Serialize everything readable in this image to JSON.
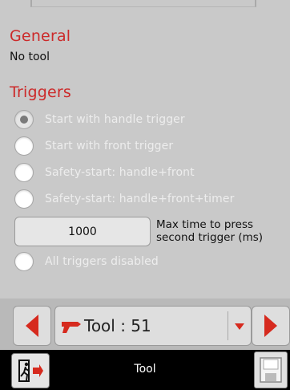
{
  "general": {
    "heading": "General",
    "tool_value": "No tool"
  },
  "triggers": {
    "heading": "Triggers",
    "options": [
      {
        "label": "Start with handle trigger",
        "checked": true
      },
      {
        "label": "Start with front trigger",
        "checked": false
      },
      {
        "label": "Safety-start: handle+front",
        "checked": false
      },
      {
        "label": "Safety-start: handle+front+timer",
        "checked": false
      }
    ],
    "max_time": {
      "value": "1000",
      "caption_line1": "Max time to press",
      "caption_line2": "second trigger (ms)"
    },
    "disable_all": {
      "label": "All triggers disabled",
      "checked": false
    }
  },
  "selector": {
    "tool_label": "Tool : 51"
  },
  "status_bar": {
    "title": "Tool"
  },
  "colors": {
    "accent_red": "#cc2a2a",
    "arrow_red": "#d62a1e"
  },
  "icons": {
    "prev": "left-arrow-icon",
    "next": "right-arrow-icon",
    "dropdown": "chevron-down-icon",
    "tool": "drill-icon",
    "exit": "exit-icon",
    "save": "save-icon"
  }
}
